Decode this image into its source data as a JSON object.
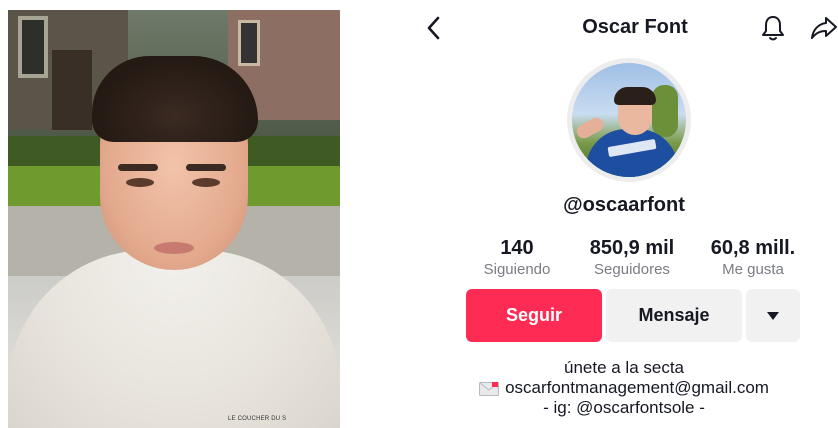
{
  "header": {
    "title": "Oscar Font"
  },
  "profile": {
    "username": "@oscaarfont",
    "stats": [
      {
        "value": "140",
        "label": "Siguiendo"
      },
      {
        "value": "850,9 mil",
        "label": "Seguidores"
      },
      {
        "value": "60,8 mill.",
        "label": "Me gusta"
      }
    ],
    "buttons": {
      "follow": "Seguir",
      "message": "Mensaje"
    },
    "bio": {
      "line1": "únete a la secta",
      "email": "oscarfontmanagement@gmail.com",
      "line3": "- ig: @oscarfontsole -"
    }
  },
  "photo": {
    "sweater_text": "LE COUCHER DU S"
  },
  "icons": {
    "back": "back-chevron-icon",
    "bell": "bell-icon",
    "share": "share-arrow-icon",
    "dropdown": "triangle-down-icon",
    "mail": "envelope-icon"
  },
  "colors": {
    "follow_button": "#fe2c55",
    "secondary_button": "#f1f1f2",
    "label_gray": "#7a7c84",
    "text": "#161823"
  }
}
